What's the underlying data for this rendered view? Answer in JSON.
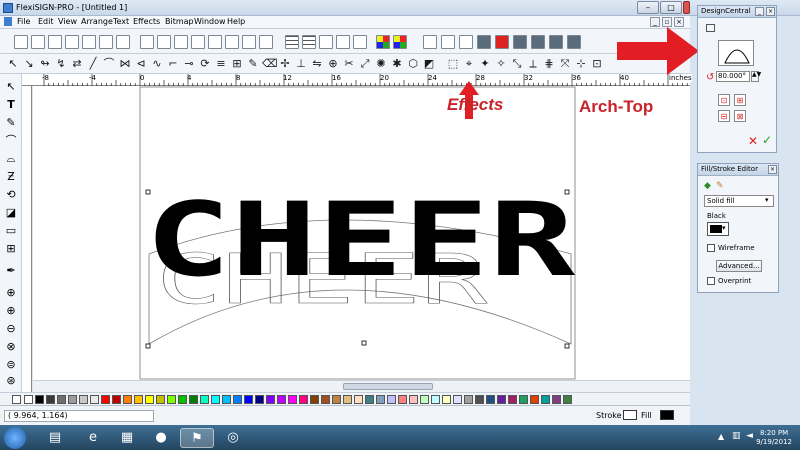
{
  "window": {
    "title": "FlexiSIGN-PRO - [Untitled 1]"
  },
  "menu": {
    "items": [
      "File",
      "Edit",
      "View",
      "Arrange",
      "Text",
      "Effects",
      "Bitmap",
      "Window",
      "Help"
    ]
  },
  "ruler": {
    "labels": [
      "-8",
      "-4",
      "0",
      "4",
      "8",
      "12",
      "16",
      "20",
      "24",
      "28",
      "32",
      "36",
      "40"
    ],
    "unit": "inches"
  },
  "canvas": {
    "text": "CHEER"
  },
  "annotations": {
    "effects": "Effects",
    "arch_top": "Arch-Top"
  },
  "design_central": {
    "title": "DesignCentral",
    "angle_value": "80.000°"
  },
  "fill_stroke": {
    "title": "Fill/Stroke Editor",
    "fill_type": "Solid fill",
    "color_name": "Black",
    "wireframe_label": "Wireframe",
    "advanced_label": "Advanced...",
    "overprint_label": "Overprint"
  },
  "status": {
    "coords": "( 9.964,   1.164)",
    "stroke_label": "Stroke",
    "fill_label": "Fill"
  },
  "clock": {
    "time": "8:20 PM",
    "date": "9/19/2012"
  },
  "colors": {
    "annotation": "#c8222a",
    "arrow": "#e21d24",
    "accent": "#3c7fd0"
  },
  "palette": [
    "#ffffff",
    "#000000",
    "#3a3a3a",
    "#6e6e6e",
    "#9c9c9c",
    "#c8c8c8",
    "#e8e8e8",
    "#ff0000",
    "#c00000",
    "#ff8000",
    "#ffc000",
    "#ffff00",
    "#c0c000",
    "#80ff00",
    "#00c000",
    "#008000",
    "#00ffc0",
    "#00ffff",
    "#00c0ff",
    "#0080ff",
    "#0000ff",
    "#000080",
    "#8000ff",
    "#c000ff",
    "#ff00ff",
    "#ff0080",
    "#804000",
    "#a05020",
    "#c08040",
    "#e0c080",
    "#ffe0c0",
    "#408080",
    "#80a0c0",
    "#c0c0ff",
    "#ff8080",
    "#ffc0c0",
    "#c0ffc0",
    "#c0ffff",
    "#ffffc0",
    "#e0e0ff",
    "#a0a0a0",
    "#505050",
    "#205080",
    "#6020a0",
    "#a02060",
    "#20a060",
    "#e04000",
    "#00a0a0",
    "#804080",
    "#408040"
  ]
}
